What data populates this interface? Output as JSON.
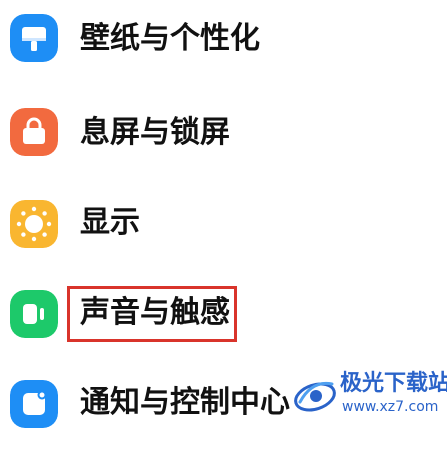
{
  "settings": {
    "items": [
      {
        "label": "壁纸与个性化",
        "icon": "wallpaper-icon",
        "color": "#1e8ef5"
      },
      {
        "label": "息屏与锁屏",
        "icon": "lock-bag-icon",
        "color": "#f26a3f"
      },
      {
        "label": "显示",
        "icon": "brightness-icon",
        "color": "#f9b630"
      },
      {
        "label": "声音与触感",
        "icon": "speaker-icon",
        "color": "#1dc96a"
      },
      {
        "label": "通知与控制中心",
        "icon": "notification-icon",
        "color": "#1e8ef5"
      }
    ],
    "highlight_color": "#d9342b"
  },
  "watermark": {
    "title": "极光下载站",
    "url": "www.xz7.com",
    "color": "#2a63c9"
  }
}
